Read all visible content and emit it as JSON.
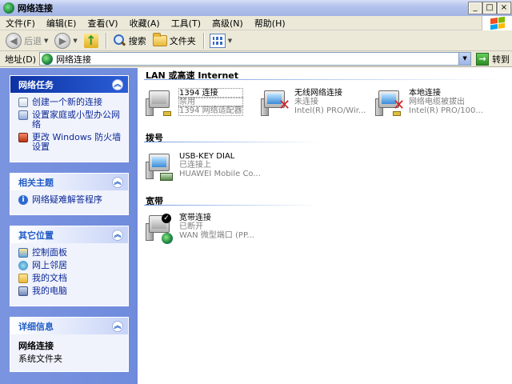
{
  "window": {
    "title": "网络连接",
    "btn_min": "_",
    "btn_max": "□",
    "btn_close": "×"
  },
  "menu": [
    "文件(F)",
    "编辑(E)",
    "查看(V)",
    "收藏(A)",
    "工具(T)",
    "高级(N)",
    "帮助(H)"
  ],
  "toolbar": {
    "back_label": "后退",
    "search_label": "搜索",
    "folders_label": "文件夹"
  },
  "address": {
    "label": "地址(D)",
    "value": "网络连接",
    "go_label": "转到"
  },
  "panels": {
    "network_tasks": {
      "title": "网络任务",
      "items": [
        "创建一个新的连接",
        "设置家庭或小型办公网络",
        "更改 Windows 防火墙设置"
      ]
    },
    "related": {
      "title": "相关主题",
      "items": [
        "网络疑难解答程序"
      ]
    },
    "other_places": {
      "title": "其它位置",
      "items": [
        "控制面板",
        "网上邻居",
        "我的文档",
        "我的电脑"
      ]
    },
    "details": {
      "title": "详细信息",
      "name": "网络连接",
      "type": "系统文件夹"
    }
  },
  "groups": {
    "lan": {
      "title": "LAN 或高速 Internet",
      "items": [
        {
          "name": "1394 连接",
          "status": "禁用",
          "device": "1394 网络适配器"
        },
        {
          "name": "无线网络连接",
          "status": "未连接",
          "device": "Intel(R) PRO/Wir..."
        },
        {
          "name": "本地连接",
          "status": "网络电缆被拔出",
          "device": "Intel(R) PRO/100..."
        }
      ]
    },
    "dialup": {
      "title": "拨号",
      "items": [
        {
          "name": "USB-KEY DIAL",
          "status": "已连接上",
          "device": "HUAWEI Mobile Co..."
        }
      ]
    },
    "broadband": {
      "title": "宽带",
      "items": [
        {
          "name": "宽带连接",
          "status": "已断开",
          "device": "WAN 微型端口 (PP..."
        }
      ]
    }
  }
}
